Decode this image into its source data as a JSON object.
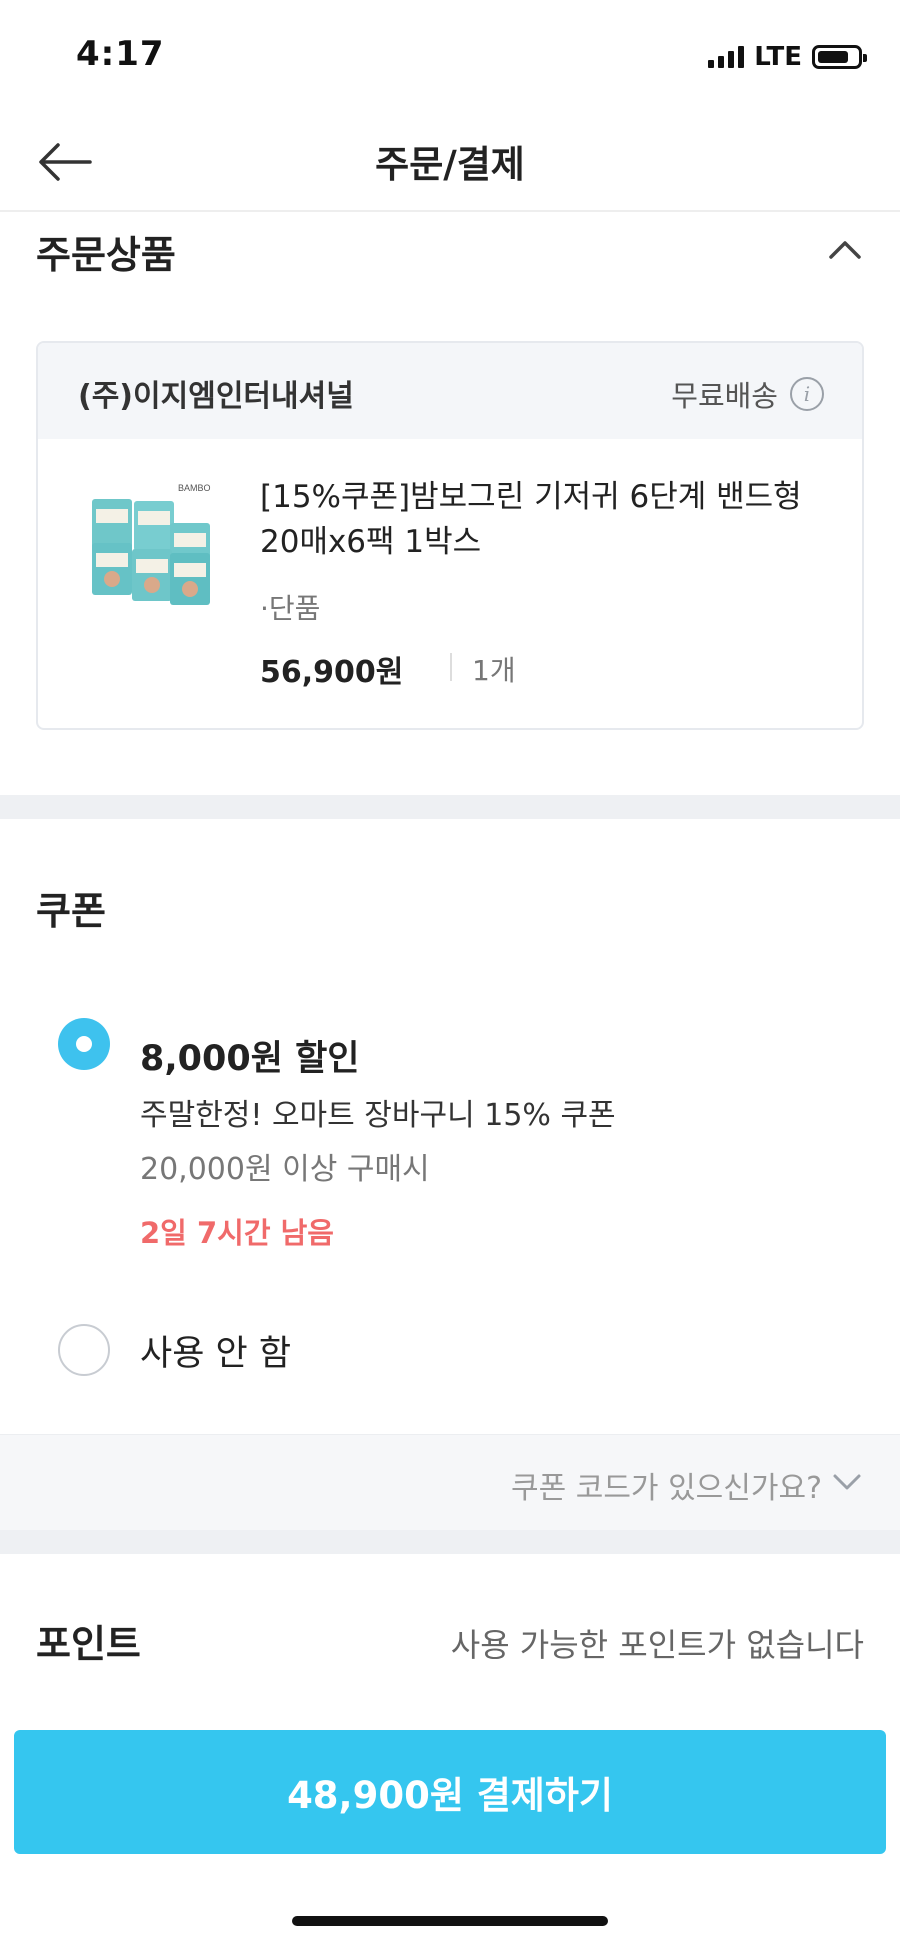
{
  "status": {
    "time": "4:17",
    "network": "LTE"
  },
  "nav": {
    "title": "주문/결제",
    "back_icon": "arrow-left-icon"
  },
  "order": {
    "section_title": "주문상품",
    "collapse_icon": "chevron-up-icon",
    "seller": "(주)이지엠인터내셔널",
    "shipping": "무료배송",
    "info_icon": "i",
    "product": {
      "image_brand": "BAMBO",
      "name": "[15%쿠폰]밤보그린 기저귀 6단계 밴드형 20매x6팩 1박스",
      "option": "·단품",
      "price": "56,900원",
      "quantity": "1개"
    }
  },
  "coupon": {
    "title": "쿠폰",
    "selected": {
      "discount": "8,000원 할인",
      "name": "주말한정! 오마트 장바구니 15% 쿠폰",
      "condition": "20,000원 이상 구매시",
      "remaining": "2일 7시간 남음"
    },
    "no_use": "사용 안 함",
    "code_prompt": "쿠폰 코드가 있으신가요?",
    "accent_color": "#3ec2ee",
    "remaining_color": "#f06a6a"
  },
  "point": {
    "title": "포인트",
    "status": "사용 가능한 포인트가 없습니다"
  },
  "pay_button": {
    "label": "48,900원 결제하기",
    "color": "#35c6ef"
  }
}
